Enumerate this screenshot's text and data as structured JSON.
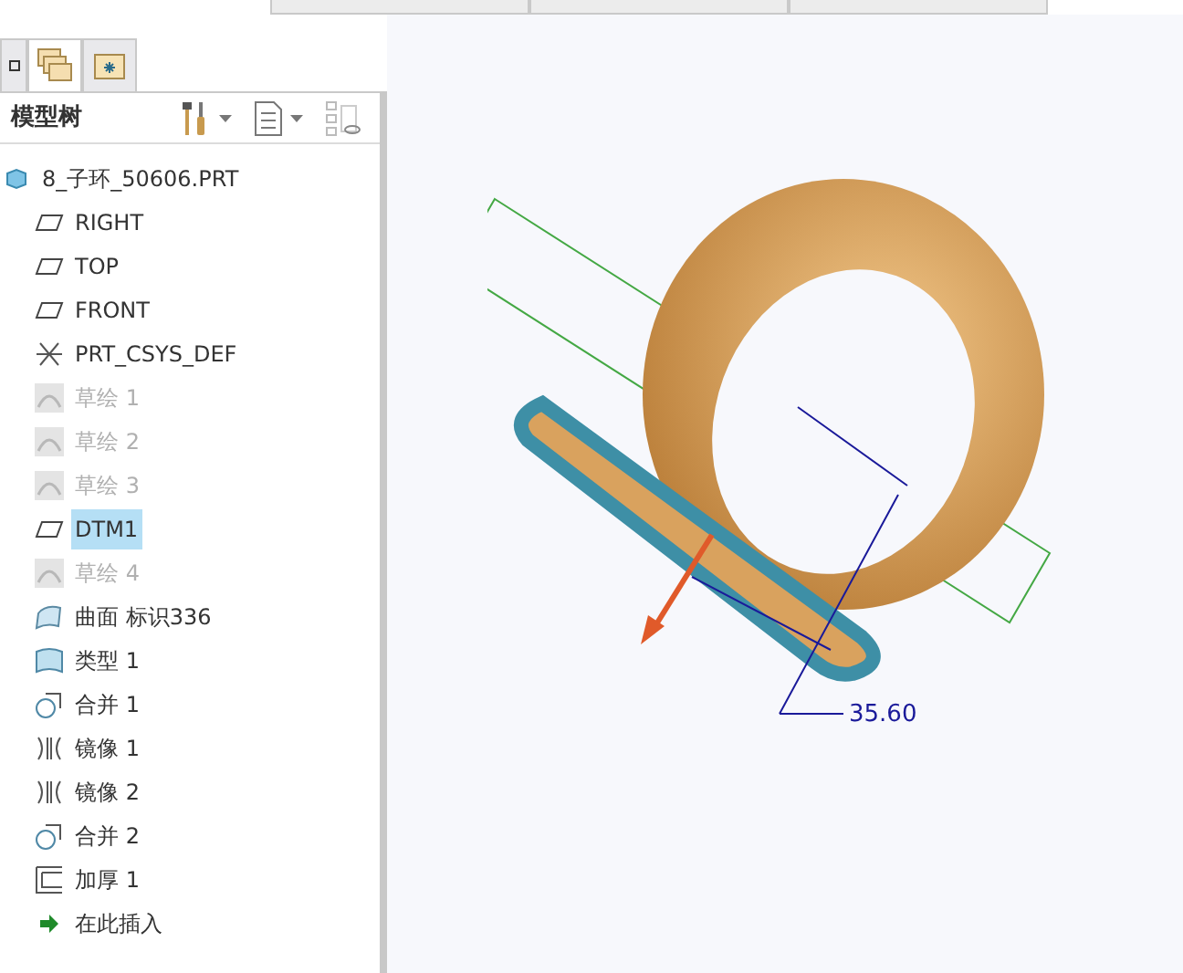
{
  "top_tabs": [
    {
      "selected": false
    },
    {
      "selected": false
    },
    {
      "selected": false
    }
  ],
  "panel_tabs": [
    {
      "kind": "layers",
      "selected": false
    },
    {
      "kind": "folders",
      "selected": true
    },
    {
      "kind": "favorites",
      "selected": false
    }
  ],
  "panel": {
    "title": "模型树"
  },
  "tree": {
    "label": "8_子环_50606.PRT",
    "kind": "part",
    "selected": false,
    "dimmed": false,
    "children": [
      {
        "label": "RIGHT",
        "kind": "plane",
        "selected": false,
        "dimmed": false
      },
      {
        "label": "TOP",
        "kind": "plane",
        "selected": false,
        "dimmed": false
      },
      {
        "label": "FRONT",
        "kind": "plane",
        "selected": false,
        "dimmed": false
      },
      {
        "label": "PRT_CSYS_DEF",
        "kind": "csys",
        "selected": false,
        "dimmed": false
      },
      {
        "label": "草绘 1",
        "kind": "sketch",
        "selected": false,
        "dimmed": true
      },
      {
        "label": "草绘 2",
        "kind": "sketch",
        "selected": false,
        "dimmed": true
      },
      {
        "label": "草绘 3",
        "kind": "sketch",
        "selected": false,
        "dimmed": true
      },
      {
        "label": "DTM1",
        "kind": "plane",
        "selected": true,
        "dimmed": false
      },
      {
        "label": "草绘 4",
        "kind": "sketch",
        "selected": false,
        "dimmed": true
      },
      {
        "label": "曲面 标识336",
        "kind": "surface",
        "selected": false,
        "dimmed": false
      },
      {
        "label": "类型 1",
        "kind": "boundary",
        "selected": false,
        "dimmed": false
      },
      {
        "label": "合并 1",
        "kind": "merge",
        "selected": false,
        "dimmed": false
      },
      {
        "label": "镜像 1",
        "kind": "mirror",
        "selected": false,
        "dimmed": false
      },
      {
        "label": "镜像 2",
        "kind": "mirror",
        "selected": false,
        "dimmed": false
      },
      {
        "label": "合并 2",
        "kind": "merge",
        "selected": false,
        "dimmed": false
      },
      {
        "label": "加厚 1",
        "kind": "thicken",
        "selected": false,
        "dimmed": false
      },
      {
        "label": "在此插入",
        "kind": "insert",
        "selected": false,
        "dimmed": false
      }
    ]
  },
  "viewport": {
    "dimension": "35.60"
  }
}
